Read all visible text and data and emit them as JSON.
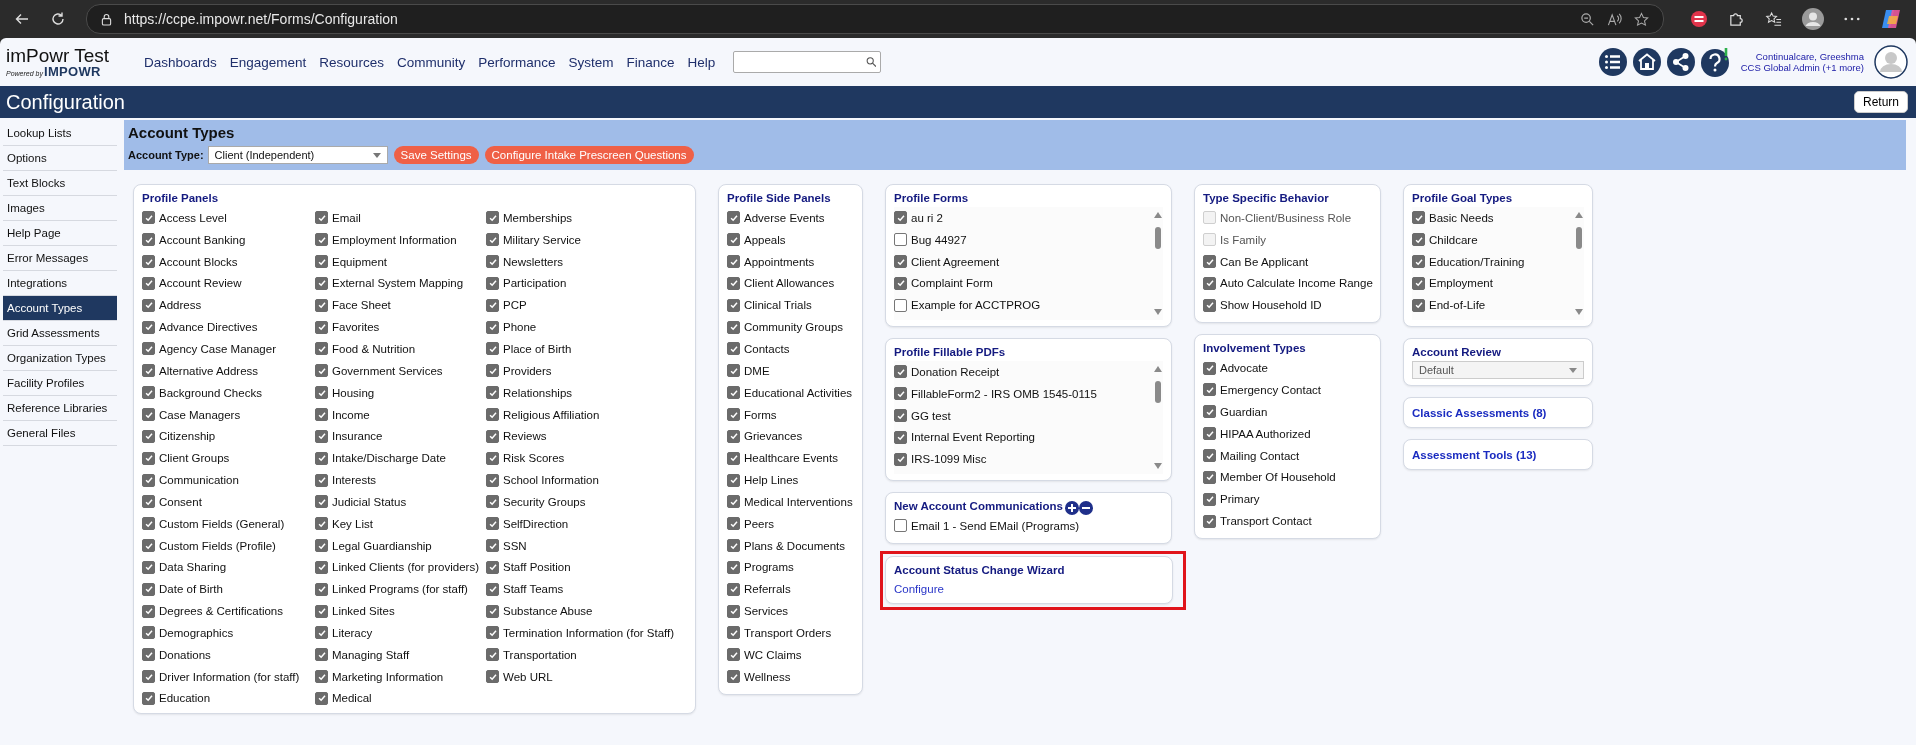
{
  "browser": {
    "url": "https://ccpe.impowr.net/Forms/Configuration"
  },
  "header": {
    "app_name": "imPowr Test",
    "powered_by": "Powered by",
    "brand": "IMPOWR",
    "nav": [
      "Dashboards",
      "Engagement",
      "Resources",
      "Community",
      "Performance",
      "System",
      "Finance",
      "Help"
    ]
  },
  "user": {
    "name": "Continualcare, Greeshma",
    "role": "CCS Global Admin (+1 more)"
  },
  "page_title": "Configuration",
  "return_button": "Return",
  "sidebar": [
    {
      "label": "Lookup Lists",
      "selected": false
    },
    {
      "label": "Options",
      "selected": false
    },
    {
      "label": "Text Blocks",
      "selected": false
    },
    {
      "label": "Images",
      "selected": false
    },
    {
      "label": "Help Page",
      "selected": false
    },
    {
      "label": "Error Messages",
      "selected": false
    },
    {
      "label": "Integrations",
      "selected": false
    },
    {
      "label": "Account Types",
      "selected": true
    },
    {
      "label": "Grid Assessments",
      "selected": false
    },
    {
      "label": "Organization Types",
      "selected": false
    },
    {
      "label": "Facility Profiles",
      "selected": false
    },
    {
      "label": "Reference Libraries",
      "selected": false
    },
    {
      "label": "General Files",
      "selected": false
    }
  ],
  "section": {
    "title": "Account Types",
    "account_type_label": "Account Type:",
    "account_type": "Client (Independent)",
    "buttons": [
      "Save Settings",
      "Configure Intake Prescreen Questions"
    ]
  },
  "profile_panels": {
    "title": "Profile Panels",
    "columns": [
      {
        "items": [
          {
            "label": "Access Level",
            "checked": true
          },
          {
            "label": "Account Banking",
            "checked": true
          },
          {
            "label": "Account Blocks",
            "checked": true
          },
          {
            "label": "Account Review",
            "checked": true
          },
          {
            "label": "Address",
            "checked": true
          },
          {
            "label": "Advance Directives",
            "checked": true
          },
          {
            "label": "Agency Case Manager",
            "checked": true
          },
          {
            "label": "Alternative Address",
            "checked": true
          },
          {
            "label": "Background Checks",
            "checked": true
          },
          {
            "label": "Case Managers",
            "checked": true
          },
          {
            "label": "Citizenship",
            "checked": true
          },
          {
            "label": "Client Groups",
            "checked": true
          },
          {
            "label": "Communication",
            "checked": true
          },
          {
            "label": "Consent",
            "checked": true
          },
          {
            "label": "Custom Fields (General)",
            "checked": true
          },
          {
            "label": "Custom Fields (Profile)",
            "checked": true
          },
          {
            "label": "Data Sharing",
            "checked": true
          },
          {
            "label": "Date of Birth",
            "checked": true
          },
          {
            "label": "Degrees & Certifications",
            "checked": true
          },
          {
            "label": "Demographics",
            "checked": true
          },
          {
            "label": "Donations",
            "checked": true
          },
          {
            "label": "Driver Information (for staff)",
            "checked": true
          },
          {
            "label": "Education",
            "checked": true
          }
        ]
      },
      {
        "items": [
          {
            "label": "Email",
            "checked": true
          },
          {
            "label": "Employment Information",
            "checked": true
          },
          {
            "label": "Equipment",
            "checked": true
          },
          {
            "label": "External System Mapping",
            "checked": true
          },
          {
            "label": "Face Sheet",
            "checked": true
          },
          {
            "label": "Favorites",
            "checked": true
          },
          {
            "label": "Food & Nutrition",
            "checked": true
          },
          {
            "label": "Government Services",
            "checked": true
          },
          {
            "label": "Housing",
            "checked": true
          },
          {
            "label": "Income",
            "checked": true
          },
          {
            "label": "Insurance",
            "checked": true
          },
          {
            "label": "Intake/Discharge Date",
            "checked": true
          },
          {
            "label": "Interests",
            "checked": true
          },
          {
            "label": "Judicial Status",
            "checked": true
          },
          {
            "label": "Key List",
            "checked": true
          },
          {
            "label": "Legal Guardianship",
            "checked": true
          },
          {
            "label": "Linked Clients (for providers)",
            "checked": true
          },
          {
            "label": "Linked Programs (for staff)",
            "checked": true
          },
          {
            "label": "Linked Sites",
            "checked": true
          },
          {
            "label": "Literacy",
            "checked": true
          },
          {
            "label": "Managing Staff",
            "checked": true
          },
          {
            "label": "Marketing Information",
            "checked": true
          },
          {
            "label": "Medical",
            "checked": true
          }
        ]
      },
      {
        "items": [
          {
            "label": "Memberships",
            "checked": true
          },
          {
            "label": "Military Service",
            "checked": true
          },
          {
            "label": "Newsletters",
            "checked": true
          },
          {
            "label": "Participation",
            "checked": true
          },
          {
            "label": "PCP",
            "checked": true
          },
          {
            "label": "Phone",
            "checked": true
          },
          {
            "label": "Place of Birth",
            "checked": true
          },
          {
            "label": "Providers",
            "checked": true
          },
          {
            "label": "Relationships",
            "checked": true
          },
          {
            "label": "Religious Affiliation",
            "checked": true
          },
          {
            "label": "Reviews",
            "checked": true
          },
          {
            "label": "Risk Scores",
            "checked": true
          },
          {
            "label": "School Information",
            "checked": true
          },
          {
            "label": "Security Groups",
            "checked": true
          },
          {
            "label": "SelfDirection",
            "checked": true
          },
          {
            "label": "SSN",
            "checked": true
          },
          {
            "label": "Staff Position",
            "checked": true
          },
          {
            "label": "Staff Teams",
            "checked": true
          },
          {
            "label": "Substance Abuse",
            "checked": true
          },
          {
            "label": "Termination Information (for Staff)",
            "checked": true
          },
          {
            "label": "Transportation",
            "checked": true
          },
          {
            "label": "Web URL",
            "checked": true
          }
        ]
      }
    ]
  },
  "side_panels": {
    "title": "Profile Side Panels",
    "items": [
      {
        "label": "Adverse Events",
        "checked": true
      },
      {
        "label": "Appeals",
        "checked": true
      },
      {
        "label": "Appointments",
        "checked": true
      },
      {
        "label": "Client Allowances",
        "checked": true
      },
      {
        "label": "Clinical Trials",
        "checked": true
      },
      {
        "label": "Community Groups",
        "checked": true
      },
      {
        "label": "Contacts",
        "checked": true
      },
      {
        "label": "DME",
        "checked": true
      },
      {
        "label": "Educational Activities",
        "checked": true
      },
      {
        "label": "Forms",
        "checked": true
      },
      {
        "label": "Grievances",
        "checked": true
      },
      {
        "label": "Healthcare Events",
        "checked": true
      },
      {
        "label": "Help Lines",
        "checked": true
      },
      {
        "label": "Medical Interventions",
        "checked": true
      },
      {
        "label": "Peers",
        "checked": true
      },
      {
        "label": "Plans & Documents",
        "checked": true
      },
      {
        "label": "Programs",
        "checked": true
      },
      {
        "label": "Referrals",
        "checked": true
      },
      {
        "label": "Services",
        "checked": true
      },
      {
        "label": "Transport Orders",
        "checked": true
      },
      {
        "label": "WC Claims",
        "checked": true
      },
      {
        "label": "Wellness",
        "checked": true
      }
    ]
  },
  "profile_forms": {
    "title": "Profile Forms",
    "items": [
      {
        "label": "au ri 2",
        "checked": true
      },
      {
        "label": "Bug 44927",
        "checked": false
      },
      {
        "label": "Client Agreement",
        "checked": true
      },
      {
        "label": "Complaint Form",
        "checked": true
      },
      {
        "label": "Example for ACCTPROG",
        "checked": false
      }
    ]
  },
  "fillable_pdfs": {
    "title": "Profile Fillable PDFs",
    "items": [
      {
        "label": "Donation Receipt",
        "checked": true
      },
      {
        "label": "FillableForm2 - IRS OMB 1545-0115",
        "checked": true
      },
      {
        "label": "GG test",
        "checked": true
      },
      {
        "label": "Internal Event Reporting",
        "checked": true
      },
      {
        "label": "IRS-1099 Misc",
        "checked": true
      }
    ]
  },
  "communications": {
    "title": "New Account Communications",
    "items": [
      {
        "label": "Email 1 - Send EMail (Programs)",
        "checked": false
      }
    ]
  },
  "wizard": {
    "title": "Account Status Change Wizard",
    "link": "Configure"
  },
  "type_behavior": {
    "title": "Type Specific Behavior",
    "items": [
      {
        "label": "Non-Client/Business Role",
        "checked": false,
        "disabled": true
      },
      {
        "label": "Is Family",
        "checked": false,
        "disabled": true
      },
      {
        "label": "Can Be Applicant",
        "checked": true,
        "disabled": false
      },
      {
        "label": "Auto Calculate Income Range",
        "checked": true,
        "disabled": false
      },
      {
        "label": "Show Household ID",
        "checked": true,
        "disabled": false
      }
    ]
  },
  "involvement": {
    "title": "Involvement Types",
    "items": [
      {
        "label": "Advocate",
        "checked": true
      },
      {
        "label": "Emergency Contact",
        "checked": true
      },
      {
        "label": "Guardian",
        "checked": true
      },
      {
        "label": "HIPAA Authorized",
        "checked": true
      },
      {
        "label": "Mailing Contact",
        "checked": true
      },
      {
        "label": "Member Of Household",
        "checked": true
      },
      {
        "label": "Primary",
        "checked": true
      },
      {
        "label": "Transport Contact",
        "checked": true
      }
    ]
  },
  "goal_types": {
    "title": "Profile Goal Types",
    "items": [
      {
        "label": "Basic Needs",
        "checked": true
      },
      {
        "label": "Childcare",
        "checked": true
      },
      {
        "label": "Education/Training",
        "checked": true
      },
      {
        "label": "Employment",
        "checked": true
      },
      {
        "label": "End-of-Life",
        "checked": true
      }
    ]
  },
  "account_review": {
    "title": "Account Review",
    "value": "Default"
  },
  "classic_assessments": "Classic Assessments (8)",
  "assessment_tools": "Assessment Tools (13)"
}
